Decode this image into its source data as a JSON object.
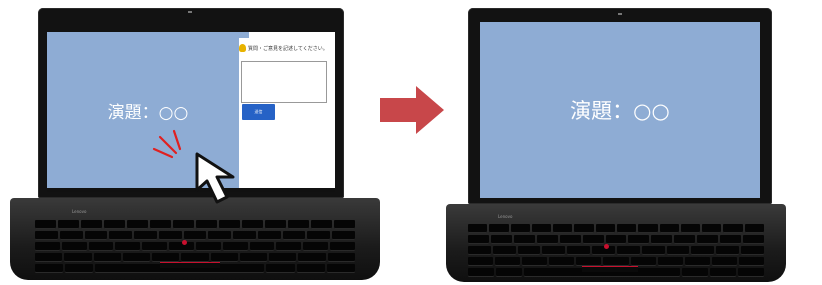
{
  "slide": {
    "title_text": "演題：○○"
  },
  "question_panel": {
    "prompt_text": "質問・ご意見を記述してください。",
    "textarea_value": "",
    "submit_label": "送信"
  },
  "laptop": {
    "brand_text": "Lenovo"
  },
  "colors": {
    "slide_bg": "#8eacd4",
    "transition_arrow": "#c8474a",
    "submit_button": "#2662c6",
    "click_marks": "#e02020"
  },
  "icons": {
    "cursor": "pointer-cursor-icon",
    "question": "question-person-icon",
    "transition": "right-arrow-icon"
  }
}
